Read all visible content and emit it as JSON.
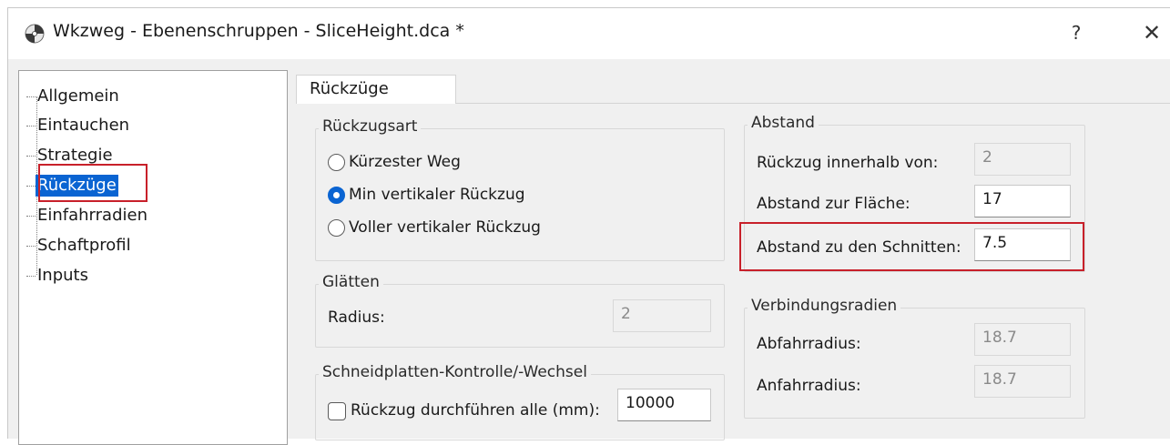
{
  "window": {
    "title": "Wkzweg - Ebenenschruppen - SliceHeight.dca *",
    "help_label": "?",
    "close_label": "✕",
    "icon": "app-icon"
  },
  "tree": {
    "items": [
      {
        "label": "Allgemein",
        "selected": false
      },
      {
        "label": "Eintauchen",
        "selected": false
      },
      {
        "label": "Strategie",
        "selected": false
      },
      {
        "label": "Rückzüge",
        "selected": true
      },
      {
        "label": "Einfahrradien",
        "selected": false
      },
      {
        "label": "Schaftprofil",
        "selected": false
      },
      {
        "label": "Inputs",
        "selected": false
      }
    ]
  },
  "tab": {
    "label": "Rückzüge"
  },
  "rueckzugsart": {
    "title": "Rückzugsart",
    "options": [
      {
        "label": "Kürzester Weg",
        "checked": false
      },
      {
        "label": "Min vertikaler Rückzug",
        "checked": true
      },
      {
        "label": "Voller vertikaler Rückzug",
        "checked": false
      }
    ]
  },
  "glaetten": {
    "title": "Glätten",
    "radius_label": "Radius:",
    "radius_value": "2"
  },
  "schneidplatten": {
    "title": "Schneidplatten-Kontrolle/-Wechsel",
    "checkbox_label": "Rückzug durchführen alle (mm):",
    "checked": false,
    "value": "10000"
  },
  "abstand": {
    "title": "Abstand",
    "innerhalb_label": "Rückzug innerhalb von:",
    "innerhalb_value": "2",
    "flaeche_label": "Abstand zur Fläche:",
    "flaeche_value": "17",
    "schnitte_label": "Abstand zu den Schnitten:",
    "schnitte_value": "7.5"
  },
  "verbindungsradien": {
    "title": "Verbindungsradien",
    "abfahr_label": "Abfahrradius:",
    "abfahr_value": "18.7",
    "anfahr_label": "Anfahrradius:",
    "anfahr_value": "18.7"
  },
  "colors": {
    "selection": "#0a64d2",
    "highlight_box": "#c8202a"
  }
}
